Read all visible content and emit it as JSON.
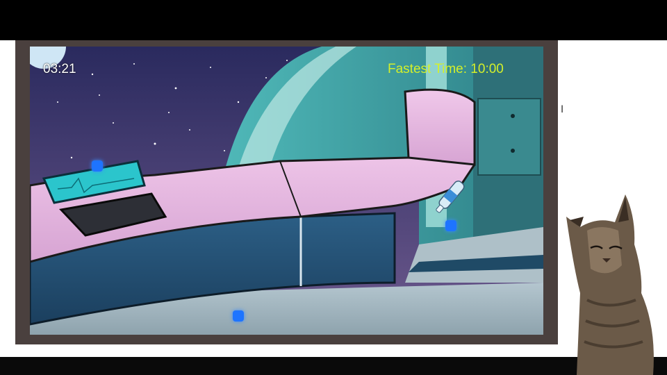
{
  "hud": {
    "timer": "03:21",
    "fastest_time": "Fastest Time: 10:00"
  },
  "hotspots": [
    {
      "name": "hotspot-monitor"
    },
    {
      "name": "hotspot-bottle"
    },
    {
      "name": "hotspot-floor"
    }
  ],
  "bottom_caption": "",
  "colors": {
    "hotspot": "#1e74ff",
    "fastest_time": "#d4f02a",
    "frame": "#4a403e"
  }
}
